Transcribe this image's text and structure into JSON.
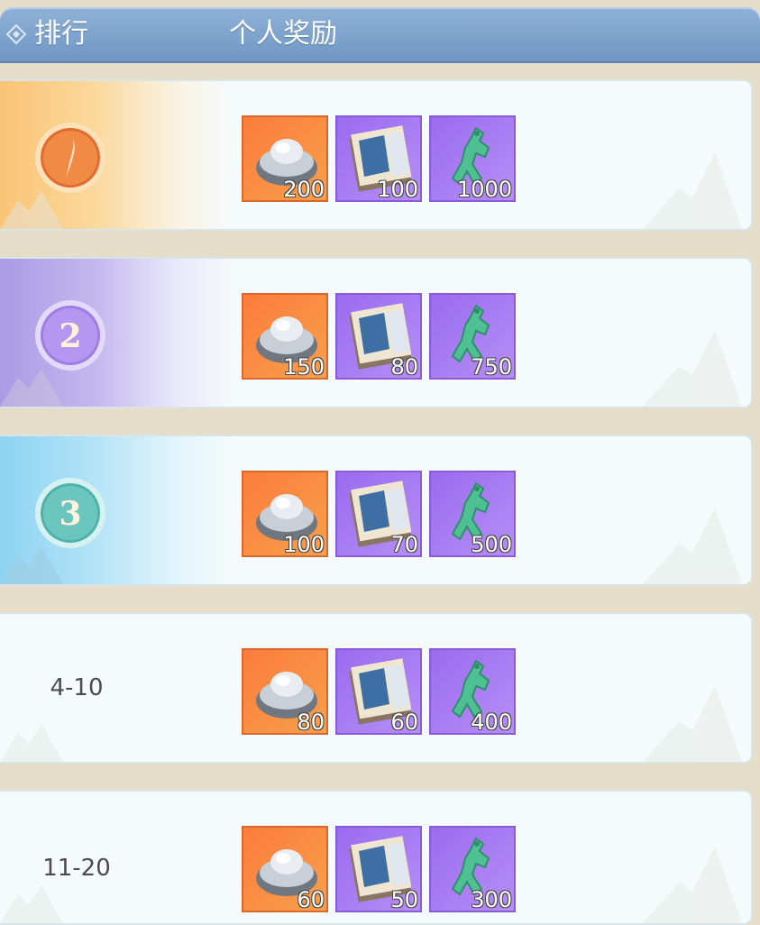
{
  "header": {
    "rank_label": "排行",
    "reward_label": "个人奖励"
  },
  "rows": [
    {
      "rank": "1",
      "rank_style": "gold",
      "rewards": [
        {
          "icon": "silver-ingot-icon",
          "qty": "200"
        },
        {
          "icon": "scroll-book-icon",
          "qty": "100"
        },
        {
          "icon": "jade-figure-icon",
          "qty": "1000"
        }
      ]
    },
    {
      "rank": "2",
      "rank_style": "purple",
      "rewards": [
        {
          "icon": "silver-ingot-icon",
          "qty": "150"
        },
        {
          "icon": "scroll-book-icon",
          "qty": "80"
        },
        {
          "icon": "jade-figure-icon",
          "qty": "750"
        }
      ]
    },
    {
      "rank": "3",
      "rank_style": "blue",
      "rewards": [
        {
          "icon": "silver-ingot-icon",
          "qty": "100"
        },
        {
          "icon": "scroll-book-icon",
          "qty": "70"
        },
        {
          "icon": "jade-figure-icon",
          "qty": "500"
        }
      ]
    },
    {
      "rank": "4-10",
      "rank_style": "plain",
      "rewards": [
        {
          "icon": "silver-ingot-icon",
          "qty": "80"
        },
        {
          "icon": "scroll-book-icon",
          "qty": "60"
        },
        {
          "icon": "jade-figure-icon",
          "qty": "400"
        }
      ]
    },
    {
      "rank": "11-20",
      "rank_style": "plain",
      "rewards": [
        {
          "icon": "silver-ingot-icon",
          "qty": "60"
        },
        {
          "icon": "scroll-book-icon",
          "qty": "50"
        },
        {
          "icon": "jade-figure-icon",
          "qty": "300"
        }
      ]
    }
  ],
  "colors": {
    "header_blue": "#7ea3cd",
    "gold": "#f9c476",
    "purple": "#aa9be4",
    "blue": "#8dd3f2",
    "item_orange": "#fb7c3b",
    "item_purple": "#9a6bf0"
  }
}
